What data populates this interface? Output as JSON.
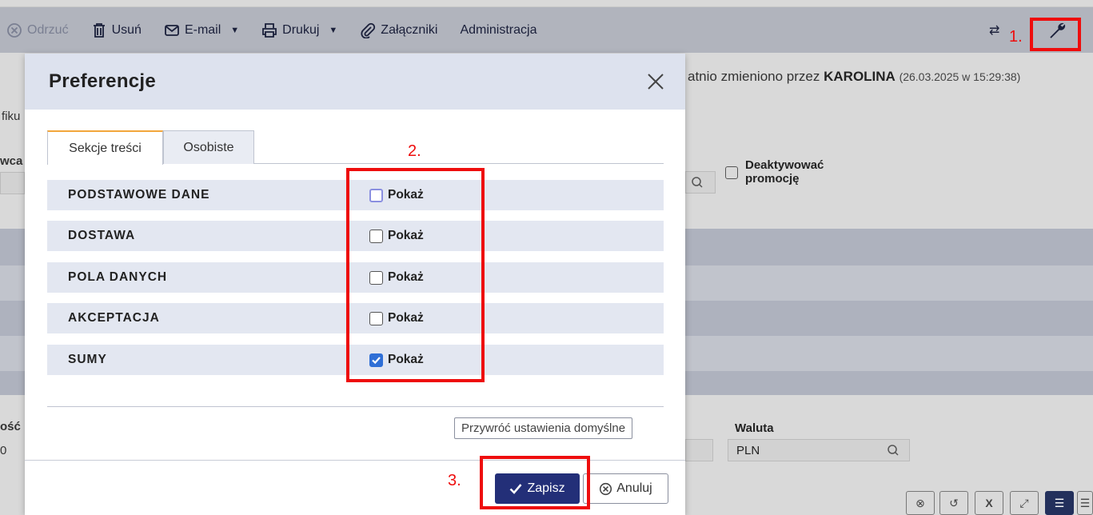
{
  "toolbar": {
    "reject": "Odrzuć",
    "delete": "Usuń",
    "email": "E-mail",
    "print": "Drukuj",
    "attachments": "Załączniki",
    "administration": "Administracja"
  },
  "background": {
    "changed_prefix": "atnio zmieniono przez",
    "changed_user": "KAROLINA",
    "changed_date": "(26.03.2025 w 15:29:38)",
    "deactivate_label_1": "Deaktywować",
    "deactivate_label_2": "promocję",
    "currency_label": "Waluta",
    "currency_value": "PLN",
    "left_fragment_1": "fiku",
    "left_fragment_2": "wca",
    "left_fragment_3": "ość",
    "left_fragment_4": "0"
  },
  "modal": {
    "title": "Preferencje",
    "tabs": [
      {
        "label": "Sekcje treści",
        "active": true
      },
      {
        "label": "Osobiste",
        "active": false
      }
    ],
    "show_label": "Pokaż",
    "sections": [
      {
        "name": "PODSTAWOWE DANE",
        "checked": false
      },
      {
        "name": "DOSTAWA",
        "checked": false
      },
      {
        "name": "POLA DANYCH",
        "checked": false
      },
      {
        "name": "AKCEPTACJA",
        "checked": false
      },
      {
        "name": "SUMY",
        "checked": true
      }
    ],
    "reset_label": "Przywróć ustawienia domyślne",
    "save_label": "Zapisz",
    "cancel_label": "Anuluj"
  },
  "annotations": {
    "step1": "1.",
    "step2": "2.",
    "step3": "3."
  },
  "colors": {
    "accent": "#232f78",
    "annotation": "#ee0d0d",
    "tab_highlight": "#f2a63b",
    "checkbox_checked": "#2f6fd6"
  }
}
